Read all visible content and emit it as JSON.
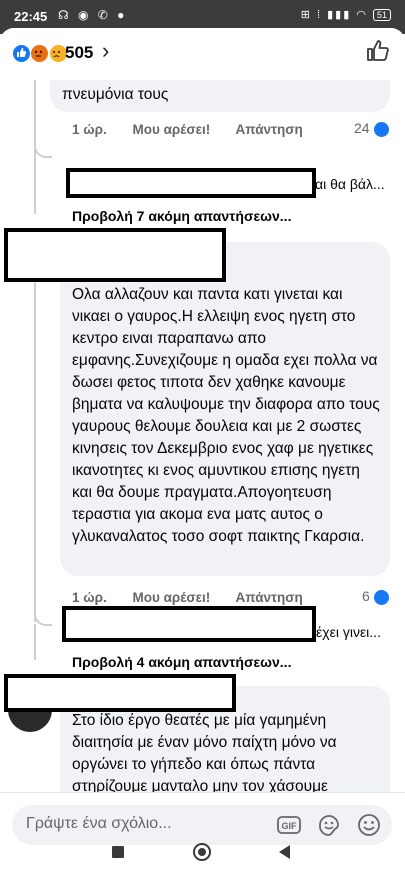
{
  "statusbar": {
    "time": "22:45",
    "left_icons": "☊ ◉ ✆ ●",
    "right_icons": "⊞ ⁞ ▮▮▮ ◠",
    "battery": "51"
  },
  "header": {
    "reaction_count": "505",
    "chevron": "›"
  },
  "comments": [
    {
      "text_tail": "πνευμόνια τους",
      "time": "1 ώρ.",
      "like": "Μου αρέσει!",
      "reply": "Απάντηση",
      "reactions": "24",
      "reply_snippet": "ναι θα βάλ...",
      "view_more": "Προβολή 7 ακόμη απαντήσεων..."
    },
    {
      "text": "Ολα αλλαζουν και παντα κατι γινεται και νικαει ο γαυρος.Η ελλειψη ενος ηγετη στο κεντρο ειναι παραπανω απο εμφανης.Συνεχιζουμε η ομαδα εχει πολλα να δωσει φετος τιποτα δεν χαθηκε κανουμε βηματα να καλυψουμε την διαφορα απο τους γαυρους θελουμε δουλεια και με 2 σωστες κινησεις τον Δεκεμβριο ενος χαφ με ηγετικες ικανοτητες κι ενος αμυντικου επισης ηγετη και θα δουμε πραγματα.Απογοητευση τεραστια για ακομα ενα ματς αυτος ο γλυκαναλατος τοσο σοφτ παικτης Γκαρσια.",
      "time": "1 ώρ.",
      "like": "Μου αρέσει!",
      "reply": "Απάντηση",
      "reactions": "6",
      "reply_snippet": "έχει γινει...",
      "view_more": "Προβολή 4 ακόμη απαντήσεων..."
    },
    {
      "text": "Στο ίδιο έργο θεατές με μία γαμημένη διαιτησία με έναν μόνο παίχτη μόνο να οργώνει το γήπεδο και όπως πάντα στηρίζουμε μανταλο μην τον χάσουμε"
    }
  ],
  "composer": {
    "placeholder": "Γράψτε ένα σχόλιο...",
    "gif_label": "GIF"
  },
  "colors": {
    "accent": "#1877f2",
    "bubble": "#f0f2f5",
    "muted": "#65676b"
  }
}
